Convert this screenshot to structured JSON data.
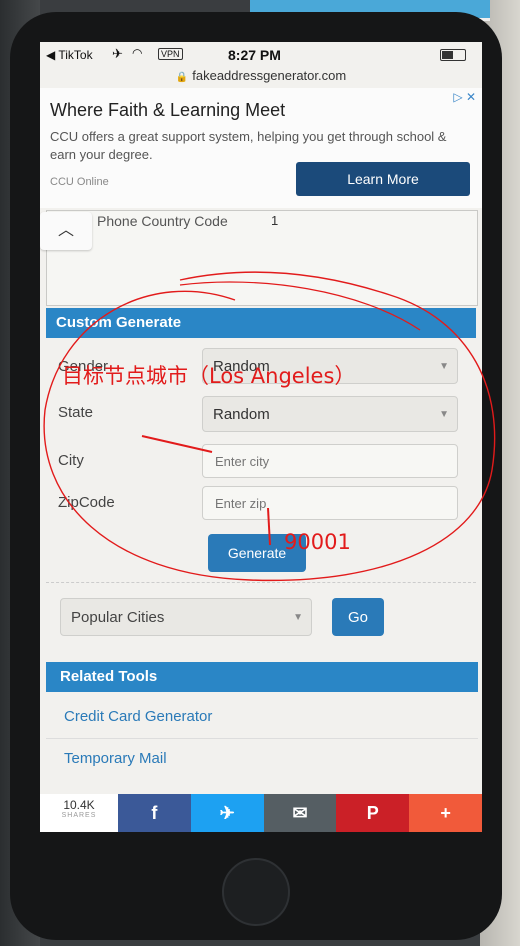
{
  "status_bar": {
    "back_app": "TikTok",
    "vpn": "VPN",
    "time": "8:27 PM",
    "url": "fakeaddressgenerator.com"
  },
  "ad": {
    "headline": "Where Faith & Learning Meet",
    "description": "CCU offers a great support system, helping you get through school & earn your degree.",
    "brand": "CCU Online",
    "cta": "Learn More"
  },
  "partial_table": {
    "label": "Phone Country Code",
    "value": "1"
  },
  "custom_generate": {
    "title": "Custom Generate",
    "gender_label": "Gender",
    "gender_value": "Random",
    "state_label": "State",
    "state_value": "Random",
    "city_label": "City",
    "city_placeholder": "Enter city",
    "zip_label": "ZipCode",
    "zip_placeholder": "Enter zip",
    "generate_label": "Generate"
  },
  "popular": {
    "selected": "Popular Cities",
    "go_label": "Go"
  },
  "related_tools": {
    "title": "Related Tools",
    "items": [
      "Credit Card Generator",
      "Temporary Mail"
    ]
  },
  "share_bar": {
    "count": "10.4K",
    "count_label": "SHARES",
    "buttons": [
      {
        "icon": "facebook-icon",
        "glyph": "f",
        "color": "#3b5998"
      },
      {
        "icon": "twitter-icon",
        "glyph": "🐦",
        "color": "#1da1f2"
      },
      {
        "icon": "email-icon",
        "glyph": "✉",
        "color": "#555e63"
      },
      {
        "icon": "pinterest-icon",
        "glyph": "P",
        "color": "#cb2027"
      },
      {
        "icon": "more-icon",
        "glyph": "+",
        "color": "#f15a3a"
      }
    ]
  },
  "annotations": {
    "city_note": "目标节点城市（Los Angeles）",
    "zip_note": "90001",
    "ink_color": "#e21b1b"
  }
}
